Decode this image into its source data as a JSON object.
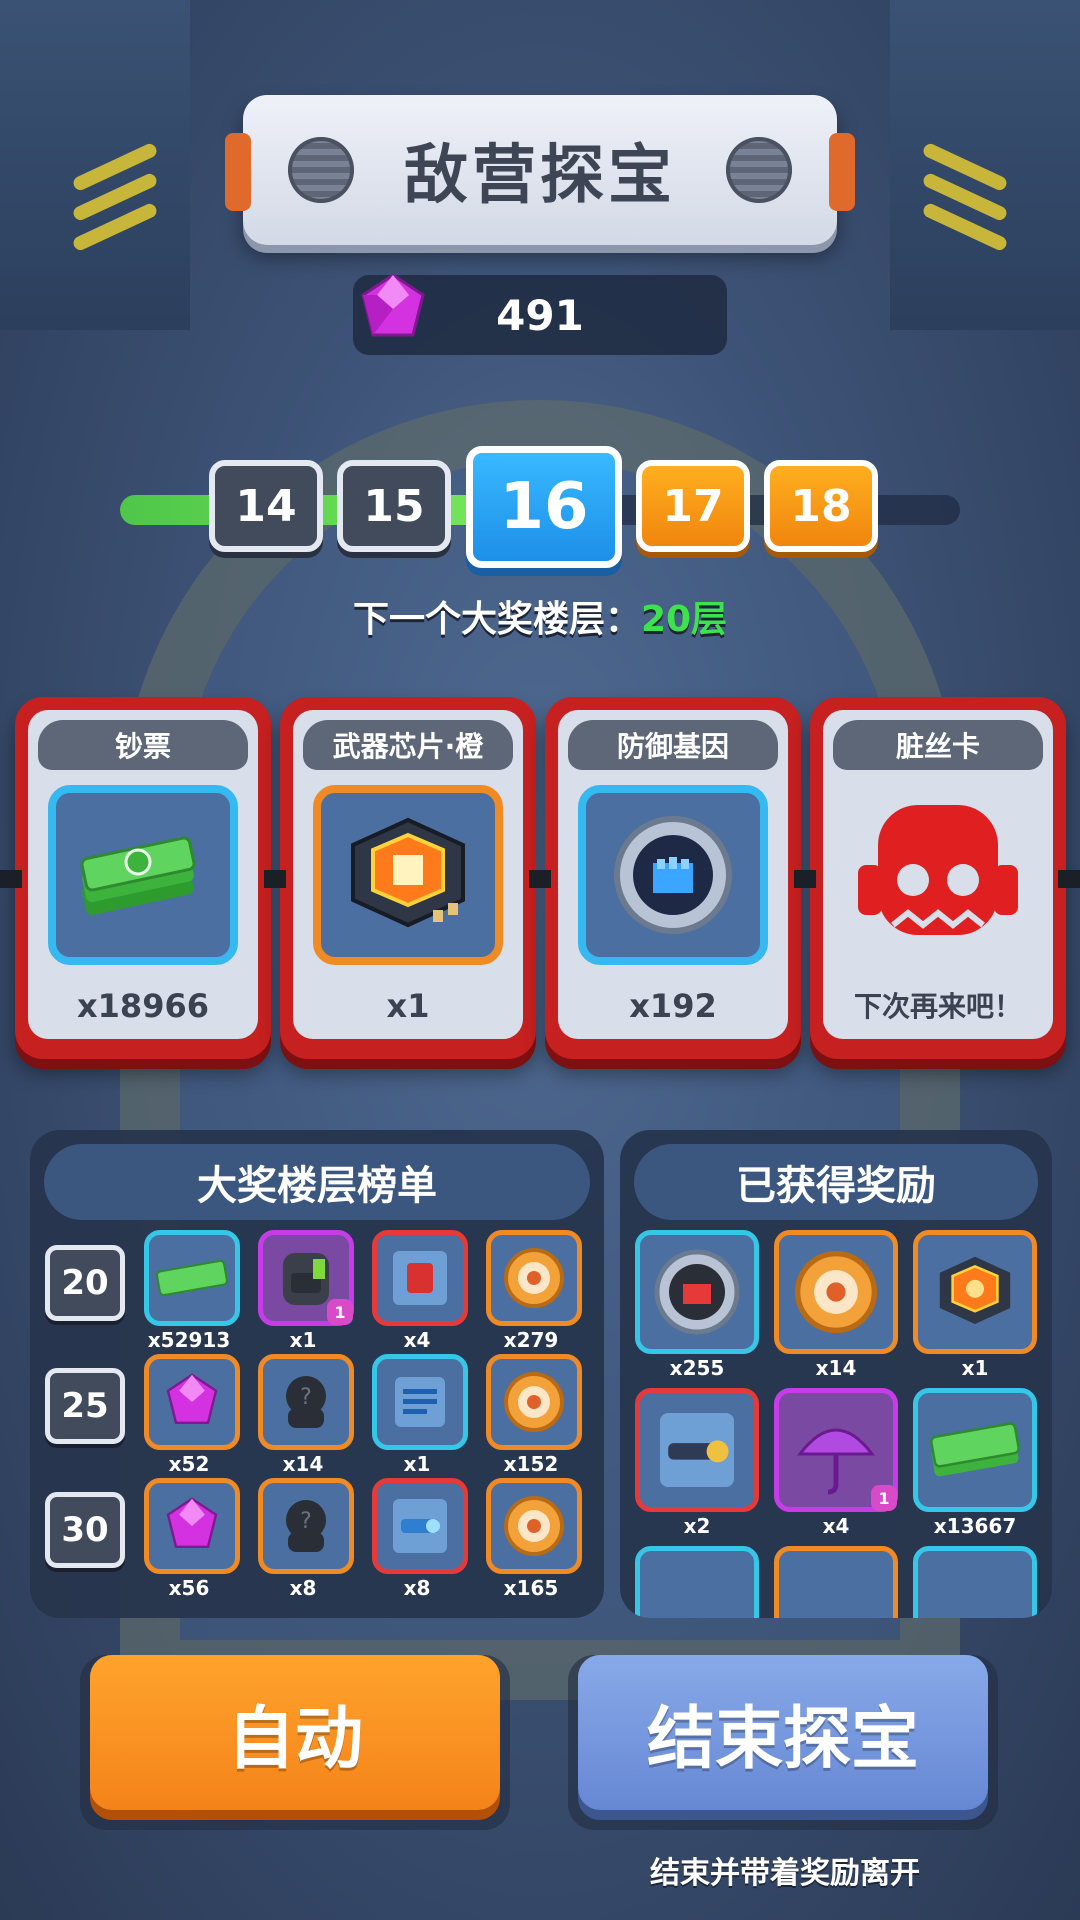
{
  "header": {
    "title": "敌营探宝"
  },
  "currency": {
    "icon": "gem-icon",
    "value": "491"
  },
  "floors": {
    "items": [
      {
        "label": "14",
        "state": "past"
      },
      {
        "label": "15",
        "state": "past"
      },
      {
        "label": "16",
        "state": "current"
      },
      {
        "label": "17",
        "state": "upcoming"
      },
      {
        "label": "18",
        "state": "upcoming"
      }
    ],
    "next_jackpot_prefix": "下一个大奖楼层：",
    "next_jackpot_value": "20层"
  },
  "cards": [
    {
      "title": "钞票",
      "icon": "cash-icon",
      "qty": "x18966"
    },
    {
      "title": "武器芯片·橙",
      "icon": "weapon-chip-icon",
      "qty": "x1"
    },
    {
      "title": "防御基因",
      "icon": "defense-gene-icon",
      "qty": "x192"
    },
    {
      "title": "脏丝卡",
      "icon": "skull-monster-icon",
      "qty": "下次再来吧！"
    }
  ],
  "jackpot_panel": {
    "title": "大奖楼层榜单",
    "rows": [
      {
        "floor": "20",
        "items": [
          {
            "icon": "cash-icon",
            "qty": "x52913"
          },
          {
            "icon": "backpack-icon",
            "qty": "x1",
            "badge": "1"
          },
          {
            "icon": "armor-card-icon",
            "qty": "x4"
          },
          {
            "icon": "target-coin-icon",
            "qty": "x279"
          }
        ]
      },
      {
        "floor": "25",
        "items": [
          {
            "icon": "gem-icon",
            "qty": "x52"
          },
          {
            "icon": "mystery-icon",
            "qty": "x14"
          },
          {
            "icon": "blueprint-icon",
            "qty": "x1"
          },
          {
            "icon": "target-coin-icon",
            "qty": "x152"
          }
        ]
      },
      {
        "floor": "30",
        "items": [
          {
            "icon": "gem-icon",
            "qty": "x56"
          },
          {
            "icon": "mystery-icon",
            "qty": "x8"
          },
          {
            "icon": "weapon-card-icon",
            "qty": "x8"
          },
          {
            "icon": "target-coin-icon",
            "qty": "x165"
          }
        ]
      }
    ]
  },
  "earned_panel": {
    "title": "已获得奖励",
    "items": [
      {
        "icon": "fist-gene-icon",
        "qty": "x255"
      },
      {
        "icon": "target-coin-icon",
        "qty": "x14"
      },
      {
        "icon": "gear-chip-icon",
        "qty": "x1"
      },
      {
        "icon": "cannon-card-icon",
        "qty": "x2"
      },
      {
        "icon": "umbrella-icon",
        "qty": "x4",
        "badge": "1"
      },
      {
        "icon": "cash-icon",
        "qty": "x13667"
      }
    ]
  },
  "buttons": {
    "auto_label": "自动",
    "end_label": "结束探宝",
    "end_hint": "结束并带着奖励离开"
  },
  "colors": {
    "accent_green": "#3ee24e",
    "current_floor": "#1d8fe8",
    "upcoming_floor": "#f0860d",
    "card_red": "#c62020"
  }
}
